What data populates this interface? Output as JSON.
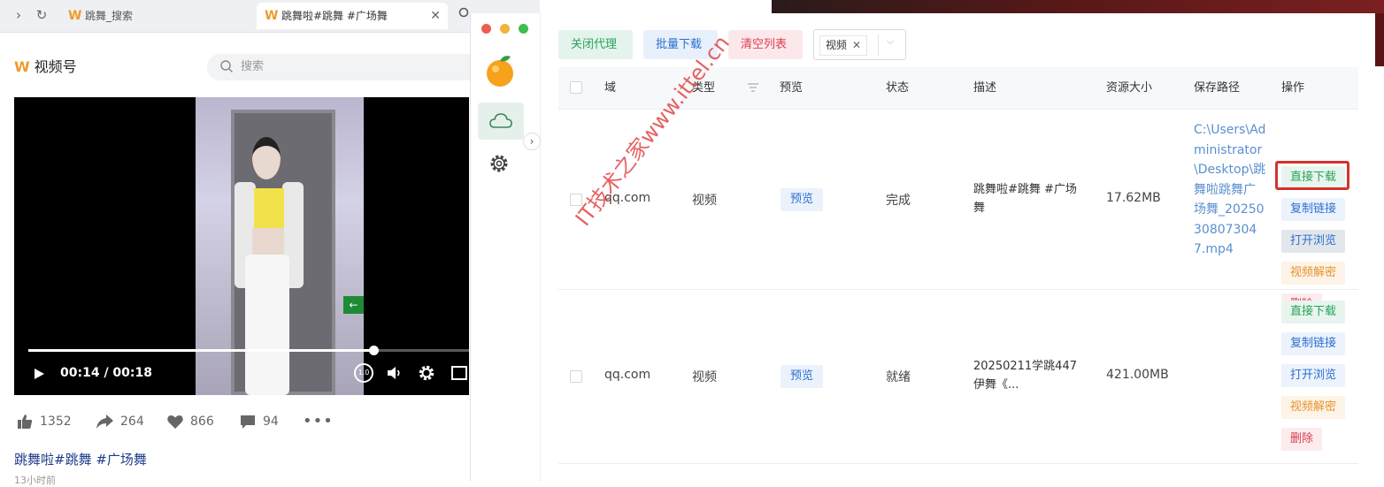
{
  "browser": {
    "tabs": [
      {
        "label": "跳舞_搜索",
        "active": false
      },
      {
        "label": "跳舞啦#跳舞 #广场舞",
        "active": true
      }
    ],
    "tab_close": "✕",
    "brand_logo": "W",
    "brand_name": "视频号",
    "search_placeholder": "搜索"
  },
  "video": {
    "time": "00:14 / 00:18",
    "progress_fraction": 0.78,
    "speed_label": "1.0",
    "exit_sign": "←"
  },
  "stats": {
    "likes": "1352",
    "shares": "264",
    "favorites": "866",
    "comments": "94",
    "more": "•••"
  },
  "post": {
    "title": "跳舞啦#跳舞 #广场舞",
    "time": "13小时前"
  },
  "app": {
    "toolbar": {
      "proxy_label": "关闭代理",
      "batch_label": "批量下载",
      "clear_label": "清空列表",
      "type_tag": "视频",
      "tag_close": "✕",
      "chevron": "⌵"
    },
    "collapse_arrow": "›",
    "columns": {
      "domain": "域",
      "type": "类型",
      "preview": "预览",
      "status": "状态",
      "desc": "描述",
      "size": "资源大小",
      "path": "保存路径",
      "action": "操作"
    },
    "rows": [
      {
        "domain": "qq.com",
        "type": "视频",
        "preview": "预览",
        "status": "完成",
        "desc": "跳舞啦#跳舞 #广场舞",
        "size": "17.62MB",
        "path": "C:\\Users\\Administrator\\Desktop\\跳舞啦跳舞广场舞_20250308073047.mp4"
      },
      {
        "domain": "qq.com",
        "type": "视频",
        "preview": "预览",
        "status": "就绪",
        "desc": "20250211学跳447伊舞《...",
        "size": "421.00MB",
        "path": ""
      }
    ],
    "actions": {
      "download": "直接下载",
      "copy": "复制链接",
      "open": "打开浏览",
      "decrypt": "视频解密",
      "delete": "删除"
    }
  },
  "watermark": "IT技术之家www.ittel.cn",
  "colors": {
    "green": "#27a35a",
    "blue": "#2b6fd1",
    "red": "#d94050",
    "orange": "#e6932e",
    "highlight": "#d6312d",
    "brand": "#f09a2c"
  }
}
